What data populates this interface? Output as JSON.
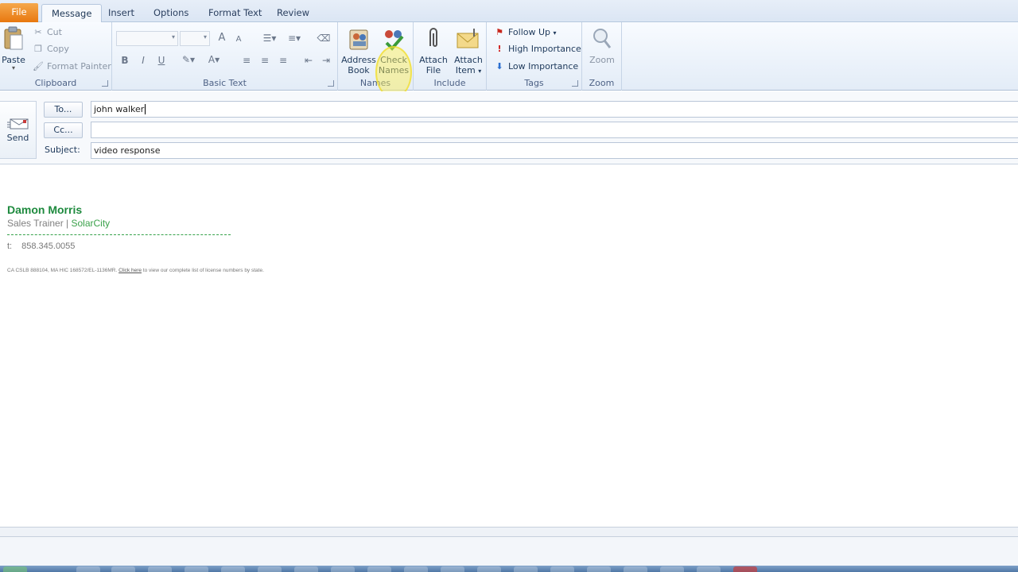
{
  "tabs": [
    {
      "label": "File"
    },
    {
      "label": "Message"
    },
    {
      "label": "Insert"
    },
    {
      "label": "Options"
    },
    {
      "label": "Format Text"
    },
    {
      "label": "Review"
    }
  ],
  "clipboard": {
    "paste": "Paste",
    "cut": "Cut",
    "copy": "Copy",
    "format_painter": "Format Painter",
    "label": "Clipboard"
  },
  "basic_text": {
    "bold": "B",
    "italic": "I",
    "underline": "U",
    "font_color": "A",
    "grow": "A",
    "shrink": "A",
    "label": "Basic Text"
  },
  "names": {
    "address_book": [
      "Address",
      "Book"
    ],
    "check_names": [
      "Check",
      "Names"
    ],
    "label": "Names"
  },
  "include": {
    "attach_file": [
      "Attach",
      "File"
    ],
    "attach_item": [
      "Attach",
      "Item"
    ],
    "label": "Include"
  },
  "tags": {
    "follow_up": "Follow Up",
    "high": "High Importance",
    "low": "Low Importance",
    "label": "Tags"
  },
  "zoom": {
    "zoom": "Zoom",
    "label": "Zoom"
  },
  "header": {
    "send": "Send",
    "to_button": "To...",
    "cc_button": "Cc...",
    "subject_label": "Subject:",
    "to_value": "john walker",
    "cc_value": "",
    "subject_value": "video response"
  },
  "signature": {
    "name": "Damon Morris",
    "title": "Sales Trainer | ",
    "company": "SolarCity",
    "phone_label": "t:",
    "phone": "858.345.0055",
    "license_prefix": "CA CSLB 888104, MA HIC 168572/EL-1136MR. ",
    "license_link": "Click here",
    "license_suffix": " to view our complete list of license numbers by state."
  },
  "colors": {
    "file_tab": "#e8780f",
    "signature_green": "#1e8a3e",
    "ribbon_bg": "#e3ecf7"
  }
}
